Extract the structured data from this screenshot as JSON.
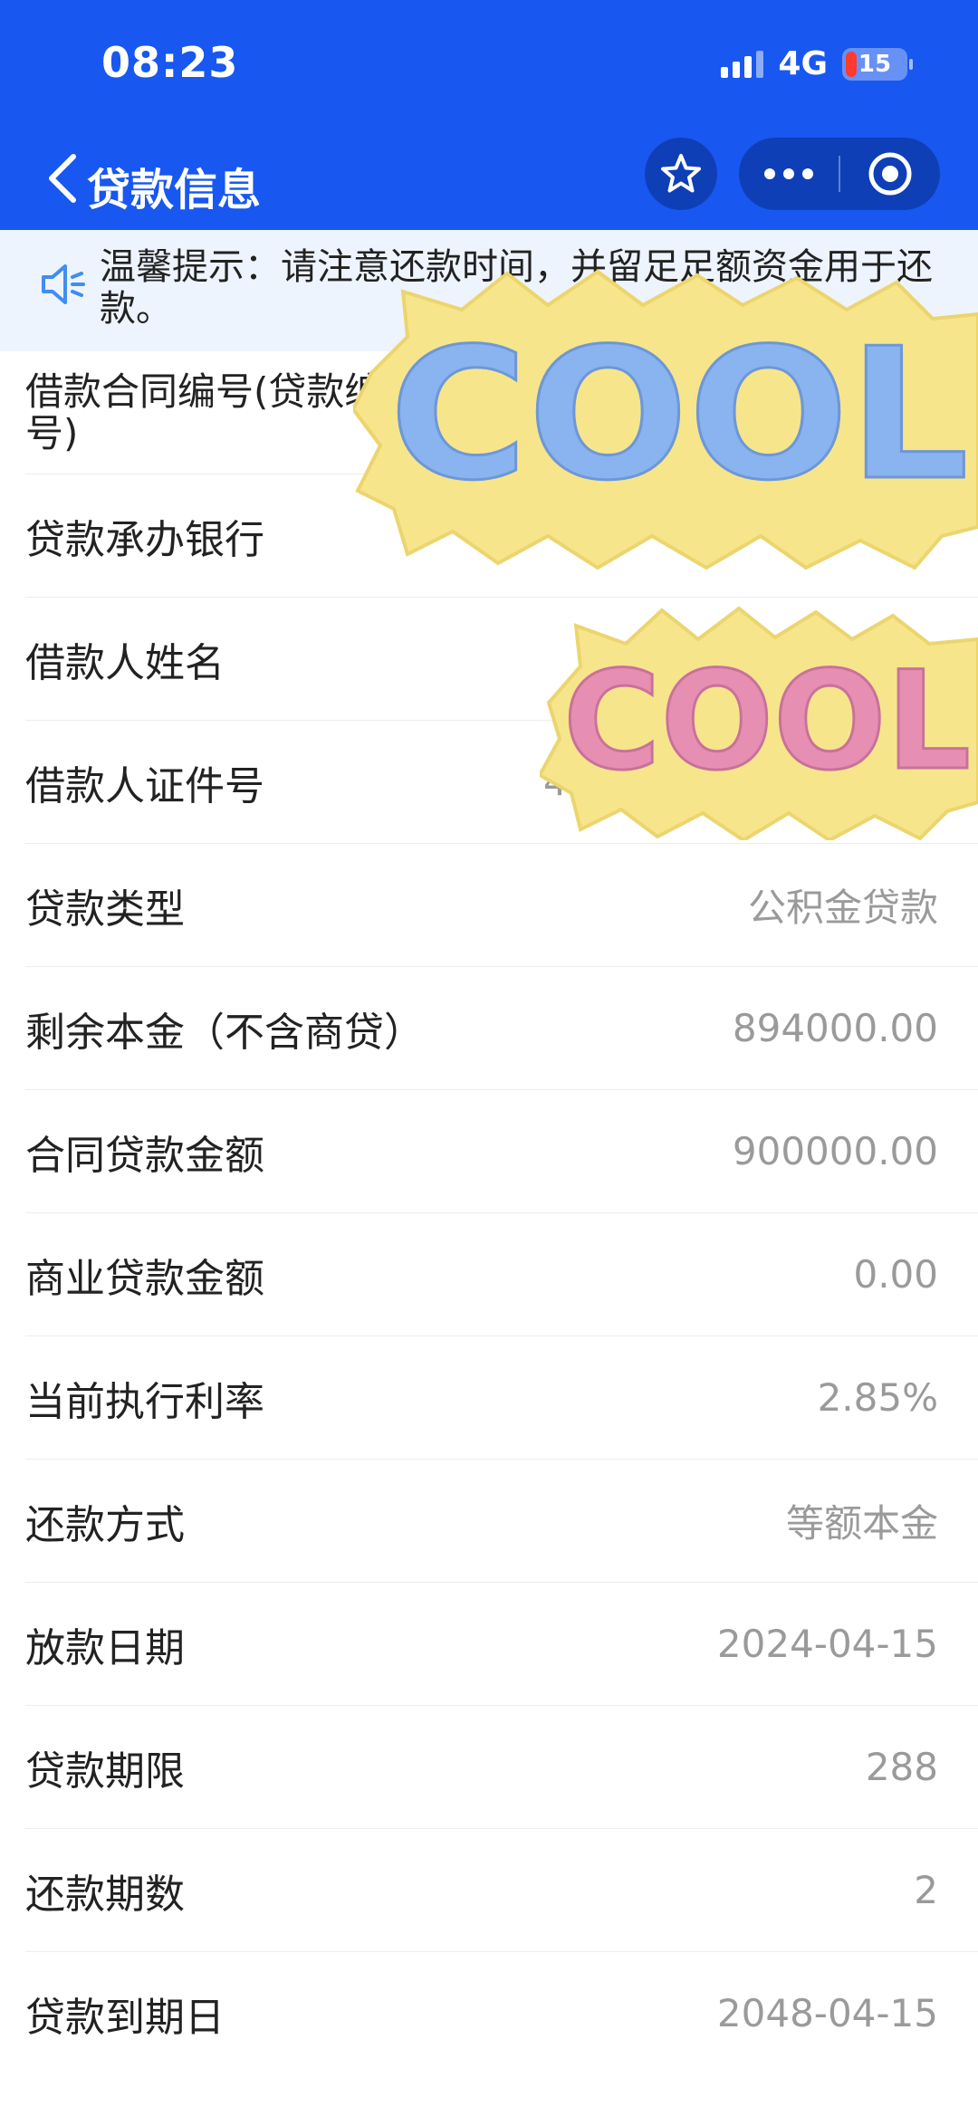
{
  "status_bar": {
    "time": "08:23",
    "network": "4G",
    "battery": "15"
  },
  "nav": {
    "title": "贷款信息"
  },
  "notice": {
    "text": "温馨提示：请注意还款时间，并留足足额资金用于还款。"
  },
  "rows": [
    {
      "label": "借款合同编号(贷款编号)",
      "value": ""
    },
    {
      "label": "贷款承办银行",
      "value": ""
    },
    {
      "label": "借款人姓名",
      "value": ""
    },
    {
      "label": "借款人证件号",
      "value": "4"
    },
    {
      "label": "贷款类型",
      "value": "公积金贷款"
    },
    {
      "label": "剩余本金（不含商贷）",
      "value": "894000.00"
    },
    {
      "label": "合同贷款金额",
      "value": "900000.00"
    },
    {
      "label": "商业贷款金额",
      "value": "0.00"
    },
    {
      "label": "当前执行利率",
      "value": "2.85%"
    },
    {
      "label": "还款方式",
      "value": "等额本金"
    },
    {
      "label": "放款日期",
      "value": "2024-04-15"
    },
    {
      "label": "贷款期限",
      "value": "288"
    },
    {
      "label": "还款期数",
      "value": "2"
    },
    {
      "label": "贷款到期日",
      "value": "2048-04-15"
    }
  ],
  "stickers": [
    {
      "text": "COOL"
    },
    {
      "text": "COOL"
    }
  ],
  "colors": {
    "brand": "#1857f0",
    "notice_bg": "#eef4fd",
    "value_gray": "#9a9a9a"
  }
}
